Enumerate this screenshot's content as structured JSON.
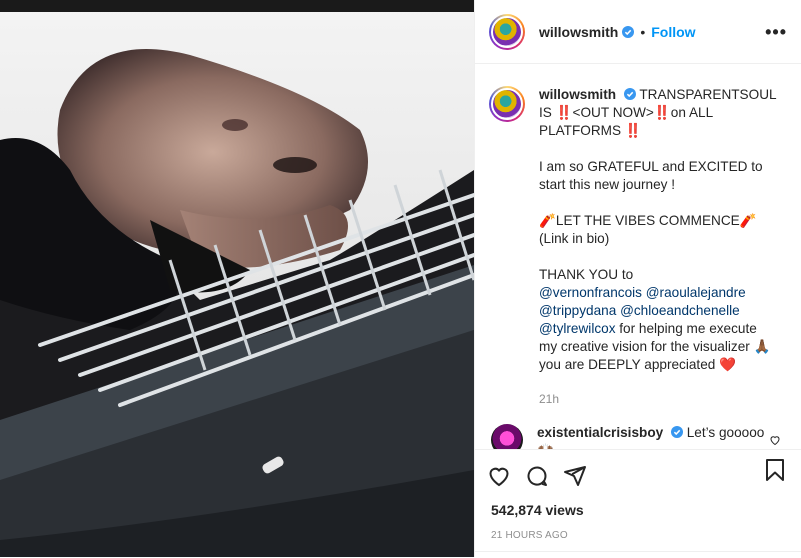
{
  "post": {
    "username": "willowsmith",
    "follow_label": "Follow",
    "separator": "•",
    "more_label": "•••"
  },
  "caption": {
    "username": "willowsmith",
    "line1": "TRANSPARENTSOUL IS ‼️<OUT NOW>‼️on ALL PLATFORMS ‼️",
    "line2": "I am so GRATEFUL and EXCITED to start this new journey !",
    "line3": "🧨LET THE VIBES COMMENCE🧨",
    "line4": "(Link in bio)",
    "thank_you": "THANK YOU to",
    "mentions": [
      "@vernonfrancois",
      "@raoulalejandre",
      "@trippydana",
      "@chloeandchenelle",
      "@tylrewilcox"
    ],
    "thank_rest": "for helping me execute my creative vision for the visualizer 🙏🏾",
    "closing": "you are DEEPLY appreciated ❤️",
    "time": "21h"
  },
  "comment": {
    "username": "existentialcrisisboy",
    "text": "Let’s gooooo🙌🏾"
  },
  "stats": {
    "views": "542,874 views",
    "time_ago": "21 HOURS AGO"
  },
  "icons": [
    "heart-icon",
    "comment-icon",
    "share-icon",
    "bookmark-icon"
  ],
  "colors": {
    "link": "#0095f6",
    "mention": "#00376b",
    "muted": "#8e8e8e",
    "verified": "#3897f0"
  }
}
